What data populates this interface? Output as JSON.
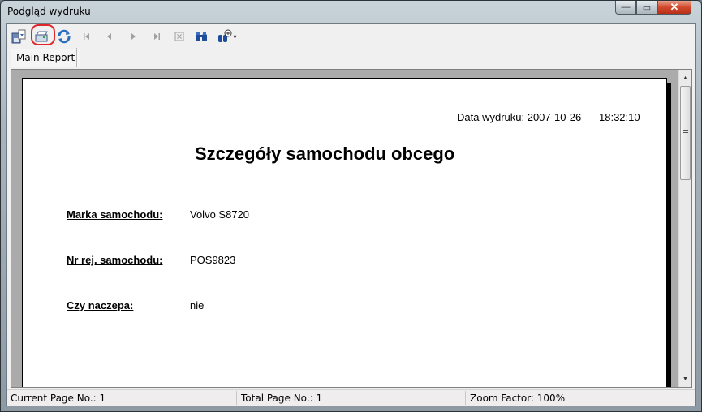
{
  "window": {
    "title": "Podgląd wydruku",
    "controls": {
      "minimize": "—",
      "maximize": "▭",
      "close": "✕"
    }
  },
  "toolbar": {
    "buttons": [
      {
        "name": "export",
        "icon": "export-icon",
        "glyph": "🖫",
        "enabled": true
      },
      {
        "name": "print",
        "icon": "printer-icon",
        "glyph": "⎙",
        "enabled": true,
        "highlighted": true
      },
      {
        "name": "refresh",
        "icon": "refresh-icon",
        "glyph": "⟳",
        "enabled": true
      },
      {
        "name": "first-page",
        "icon": "first-page-icon",
        "glyph": "⏮",
        "enabled": false
      },
      {
        "name": "previous-page",
        "icon": "previous-page-icon",
        "glyph": "◀",
        "enabled": false
      },
      {
        "name": "next-page",
        "icon": "next-page-icon",
        "glyph": "▶",
        "enabled": false
      },
      {
        "name": "last-page",
        "icon": "last-page-icon",
        "glyph": "⏭",
        "enabled": false
      },
      {
        "name": "stop",
        "icon": "stop-icon",
        "glyph": "⊠",
        "enabled": false
      },
      {
        "name": "search",
        "icon": "binoculars-icon",
        "glyph": "👓",
        "enabled": true
      },
      {
        "name": "zoom",
        "icon": "zoom-icon",
        "glyph": "🔍",
        "enabled": true,
        "dropdown": "▾"
      }
    ],
    "highlight_color": "#e0262a"
  },
  "tabs": [
    {
      "label": "Main Report",
      "active": true
    }
  ],
  "report": {
    "print_date_label": "Data wydruku:",
    "print_date": "2007-10-26",
    "print_time": "18:32:10",
    "title": "Szczegóły samochodu obcego",
    "fields": [
      {
        "label_parts": [
          "Nr rej."
        ],
        "label": "Marka samochodu:",
        "value": "Volvo S8720"
      },
      {
        "label": "Nr rej. samochodu:",
        "value": "POS9823"
      },
      {
        "label": "Czy naczepa:",
        "value": "nie"
      }
    ]
  },
  "statusbar": {
    "current_page": "Current Page No.: 1",
    "total_pages": "Total Page No.: 1",
    "zoom_factor": "Zoom Factor: 100%"
  }
}
